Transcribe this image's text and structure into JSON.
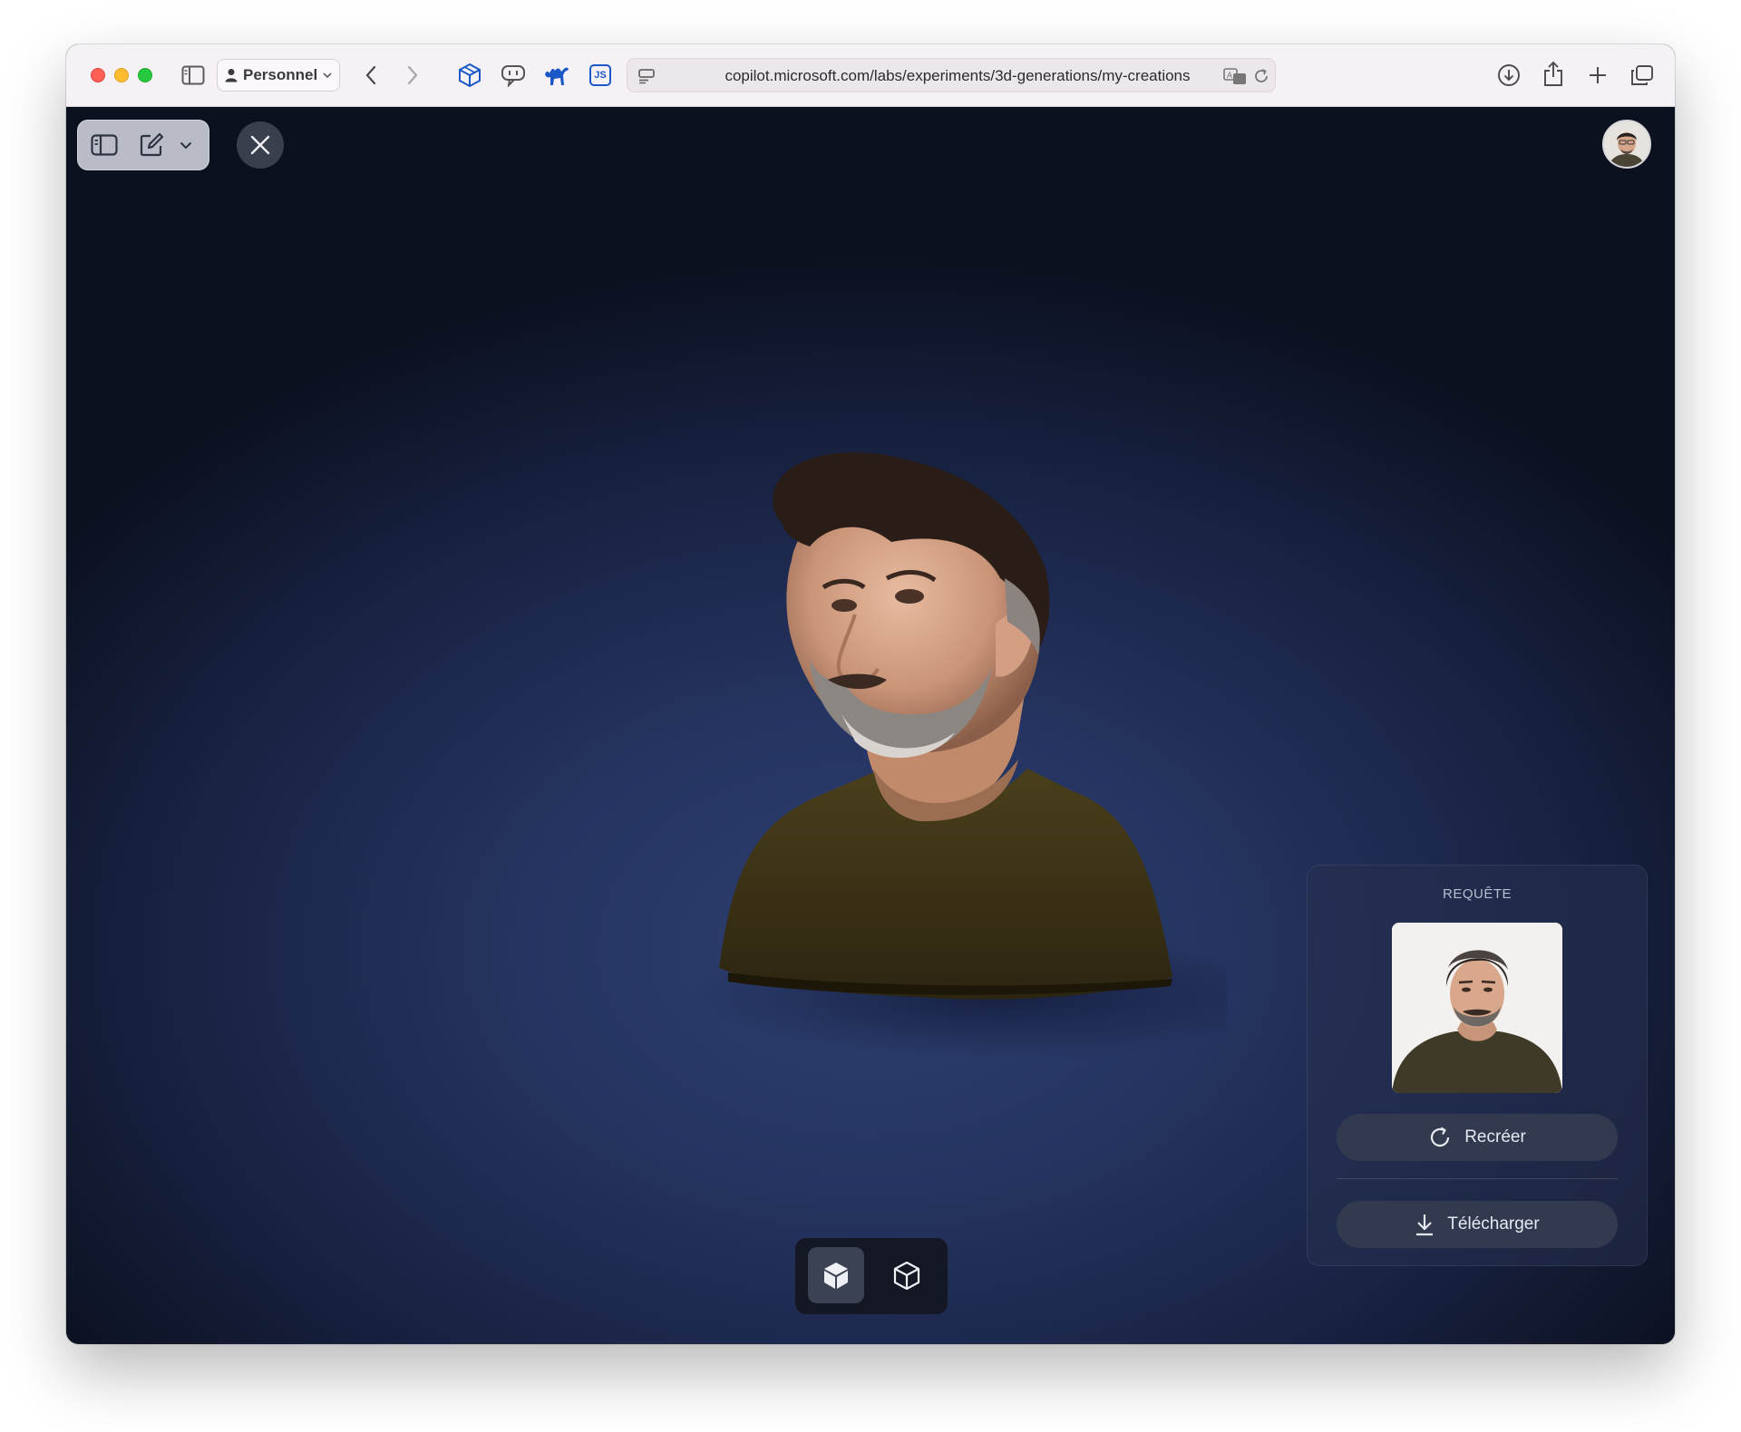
{
  "browser": {
    "profile_label": "Personnel",
    "url": "copilot.microsoft.com/labs/experiments/3d-generations/my-creations",
    "icons": [
      "sidebar-icon",
      "person-icon",
      "chevron-down-icon",
      "back-icon",
      "forward-icon",
      "3d-box-extension-icon",
      "speech-extension-icon",
      "camel-extension-icon",
      "js-extension-icon",
      "page-menu-icon",
      "translate-icon",
      "reload-icon",
      "download-icon",
      "share-icon",
      "new-tab-icon",
      "tabs-overview-icon"
    ],
    "extension_js_label": "JS"
  },
  "viewer": {
    "icons": [
      "sidebar-toggle-icon",
      "new-chat-icon",
      "chevron-down-icon",
      "close-icon",
      "solid-cube-icon",
      "wireframe-cube-icon",
      "refresh-icon",
      "download-icon"
    ],
    "mode_active": "solid"
  },
  "request_panel": {
    "title": "REQUÊTE",
    "recreate_label": "Recréer",
    "download_label": "Télécharger"
  },
  "colors": {
    "accent_blue": "#1a58c8",
    "viewer_bg": "#253461",
    "panel_button": "#323a50"
  }
}
